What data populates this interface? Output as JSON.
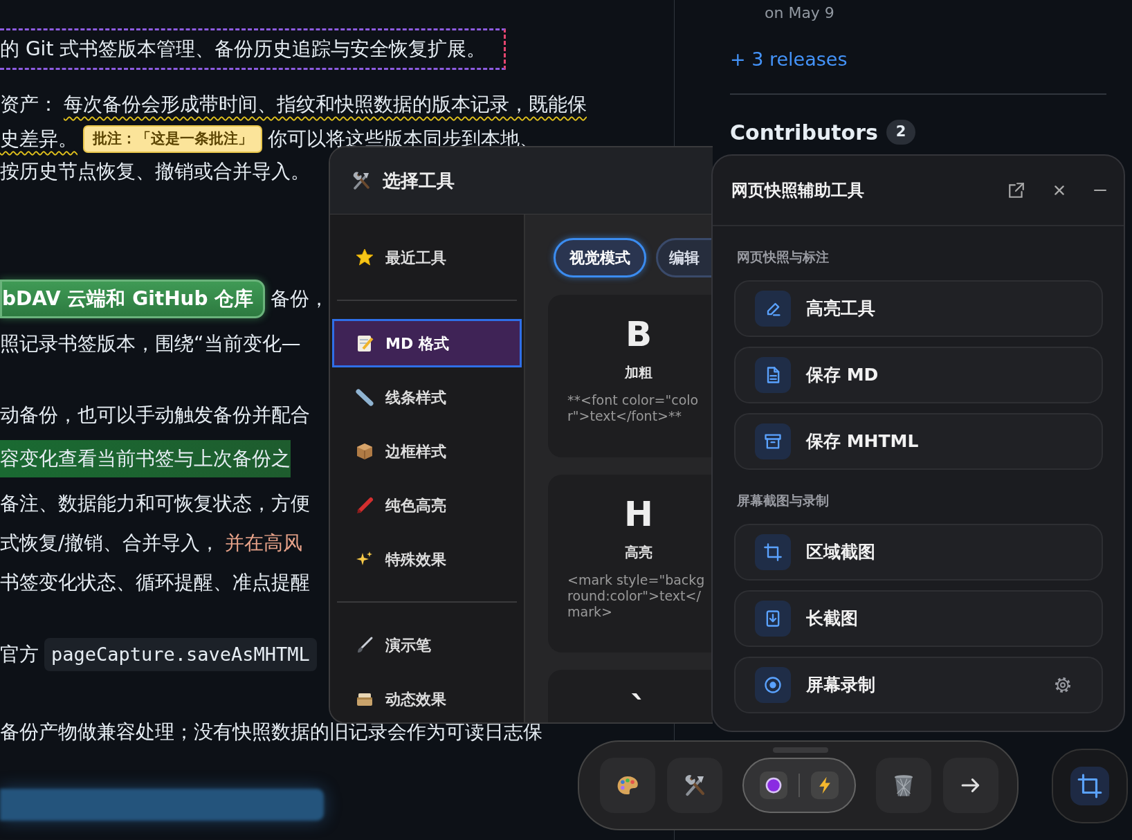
{
  "article": {
    "lines": [
      {
        "segments": [
          {
            "kind": "framed",
            "text": "的 Git 式书签版本管理、备份历史追踪与安全恢复扩展。"
          }
        ]
      },
      {
        "segments": [
          {
            "kind": "plain",
            "text": "资产："
          },
          {
            "kind": "wavy",
            "text": "每次备份会形成带时间、指纹和快照数据的版本记录，既能保"
          }
        ]
      },
      {
        "segments": [
          {
            "kind": "wavy",
            "text": "史差异。"
          },
          {
            "kind": "note",
            "text": "批注：「这是一条批注」"
          },
          {
            "kind": "plain",
            "text": "你可以将这些版本同步到本地、"
          }
        ]
      },
      {
        "segments": [
          {
            "kind": "plain",
            "text": "按历史节点恢复、撤销或合并导入。"
          }
        ]
      },
      {
        "segments": [
          {
            "kind": "pill",
            "text": "bDAV 云端和 GitHub 仓库"
          },
          {
            "kind": "plain",
            "text": "备份，"
          }
        ]
      },
      {
        "segments": [
          {
            "kind": "plain",
            "text": "照记录书签版本，围绕“当前变化—"
          }
        ]
      },
      {
        "segments": [
          {
            "kind": "plain",
            "text": "动备份，也可以手动触发备份并配合"
          }
        ]
      },
      {
        "segments": [
          {
            "kind": "highlight",
            "text": "容变化查看当前书签与上次备份之"
          }
        ]
      },
      {
        "segments": [
          {
            "kind": "plain",
            "text": "备注、数据能力和可恢复状态，方便"
          }
        ]
      },
      {
        "segments": [
          {
            "kind": "plain",
            "text": "式恢复/撤销、合并导入，"
          },
          {
            "kind": "accent",
            "text": "并在高风"
          }
        ]
      },
      {
        "segments": [
          {
            "kind": "plain",
            "text": "书签变化状态、循环提醒、准点提醒"
          }
        ]
      },
      {
        "segments": [
          {
            "kind": "plain",
            "text": "官方"
          },
          {
            "kind": "code",
            "text": "pageCapture.saveAsMHTML"
          }
        ]
      },
      {
        "segments": [
          {
            "kind": "plain",
            "text": "备份产物做兼容处理；没有快照数据的旧记录会作为可读日志保"
          }
        ]
      }
    ]
  },
  "aside": {
    "release_date": "on May 9",
    "releases_link": "+ 3 releases",
    "contributors": {
      "label": "Contributors",
      "count": "2"
    }
  },
  "tool_picker": {
    "title": "选择工具",
    "category_groups": [
      [
        {
          "label": "最近工具",
          "selected": false
        }
      ],
      [
        {
          "label": "MD 格式",
          "selected": true
        },
        {
          "label": "线条样式",
          "selected": false
        },
        {
          "label": "边框样式",
          "selected": false
        },
        {
          "label": "纯色高亮",
          "selected": false
        },
        {
          "label": "特殊效果",
          "selected": false
        }
      ],
      [
        {
          "label": "演示笔",
          "selected": false
        },
        {
          "label": "动态效果",
          "selected": false
        }
      ]
    ],
    "modes": [
      {
        "label": "视觉模式",
        "selected": true
      },
      {
        "label": "编辑",
        "selected": false
      }
    ],
    "cards": [
      {
        "glyph": "B",
        "label": "加粗",
        "syntax": "**<font color=\"color\">text</font>**"
      },
      {
        "glyph": "H",
        "label": "高亮",
        "syntax": "<mark style=\"background:color\">text</mark>"
      },
      {
        "glyph": "`"
      }
    ]
  },
  "snapshot_panel": {
    "title": "网页快照辅助工具",
    "sections": [
      {
        "heading": "网页快照与标注",
        "items": [
          {
            "label": "高亮工具",
            "settings": false
          },
          {
            "label": "保存 MD",
            "settings": false
          },
          {
            "label": "保存 MHTML",
            "settings": false
          }
        ]
      },
      {
        "heading": "屏幕截图与录制",
        "items": [
          {
            "label": "区域截图",
            "settings": false
          },
          {
            "label": "长截图",
            "settings": false
          },
          {
            "label": "屏幕录制",
            "settings": true
          }
        ]
      }
    ]
  }
}
